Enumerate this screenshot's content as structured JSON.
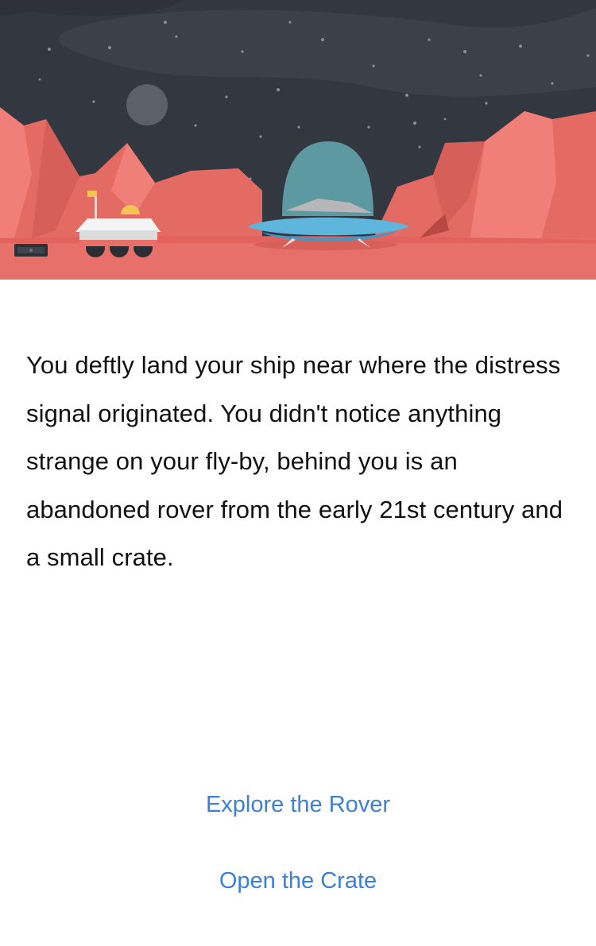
{
  "scene": {
    "icons": [
      "planet-icon",
      "rover-icon",
      "flag-icon",
      "ufo-ship-icon",
      "crate-icon",
      "stars-icon"
    ],
    "colors": {
      "sky": "#33373f",
      "haze": "#3b4049",
      "ground": "#e8706b",
      "mountain": "#e46b64",
      "mountain_light": "#ef7f78",
      "mountain_dark": "#c9534f",
      "planet": "#5b6169",
      "ship_dome": "#5f9ea5",
      "ship_body": "#5fb6dc",
      "rover": "#f4f4f4"
    }
  },
  "story": {
    "text": "You deftly land your ship near where the distress signal originated. You didn't notice anything strange on your fly-by, behind you is an abandoned rover from the early 21st century and a small crate."
  },
  "choices": [
    {
      "label": "Explore the Rover"
    },
    {
      "label": "Open the Crate"
    }
  ],
  "theme": {
    "link_color": "#3c7fd6",
    "text_color": "#111111"
  }
}
